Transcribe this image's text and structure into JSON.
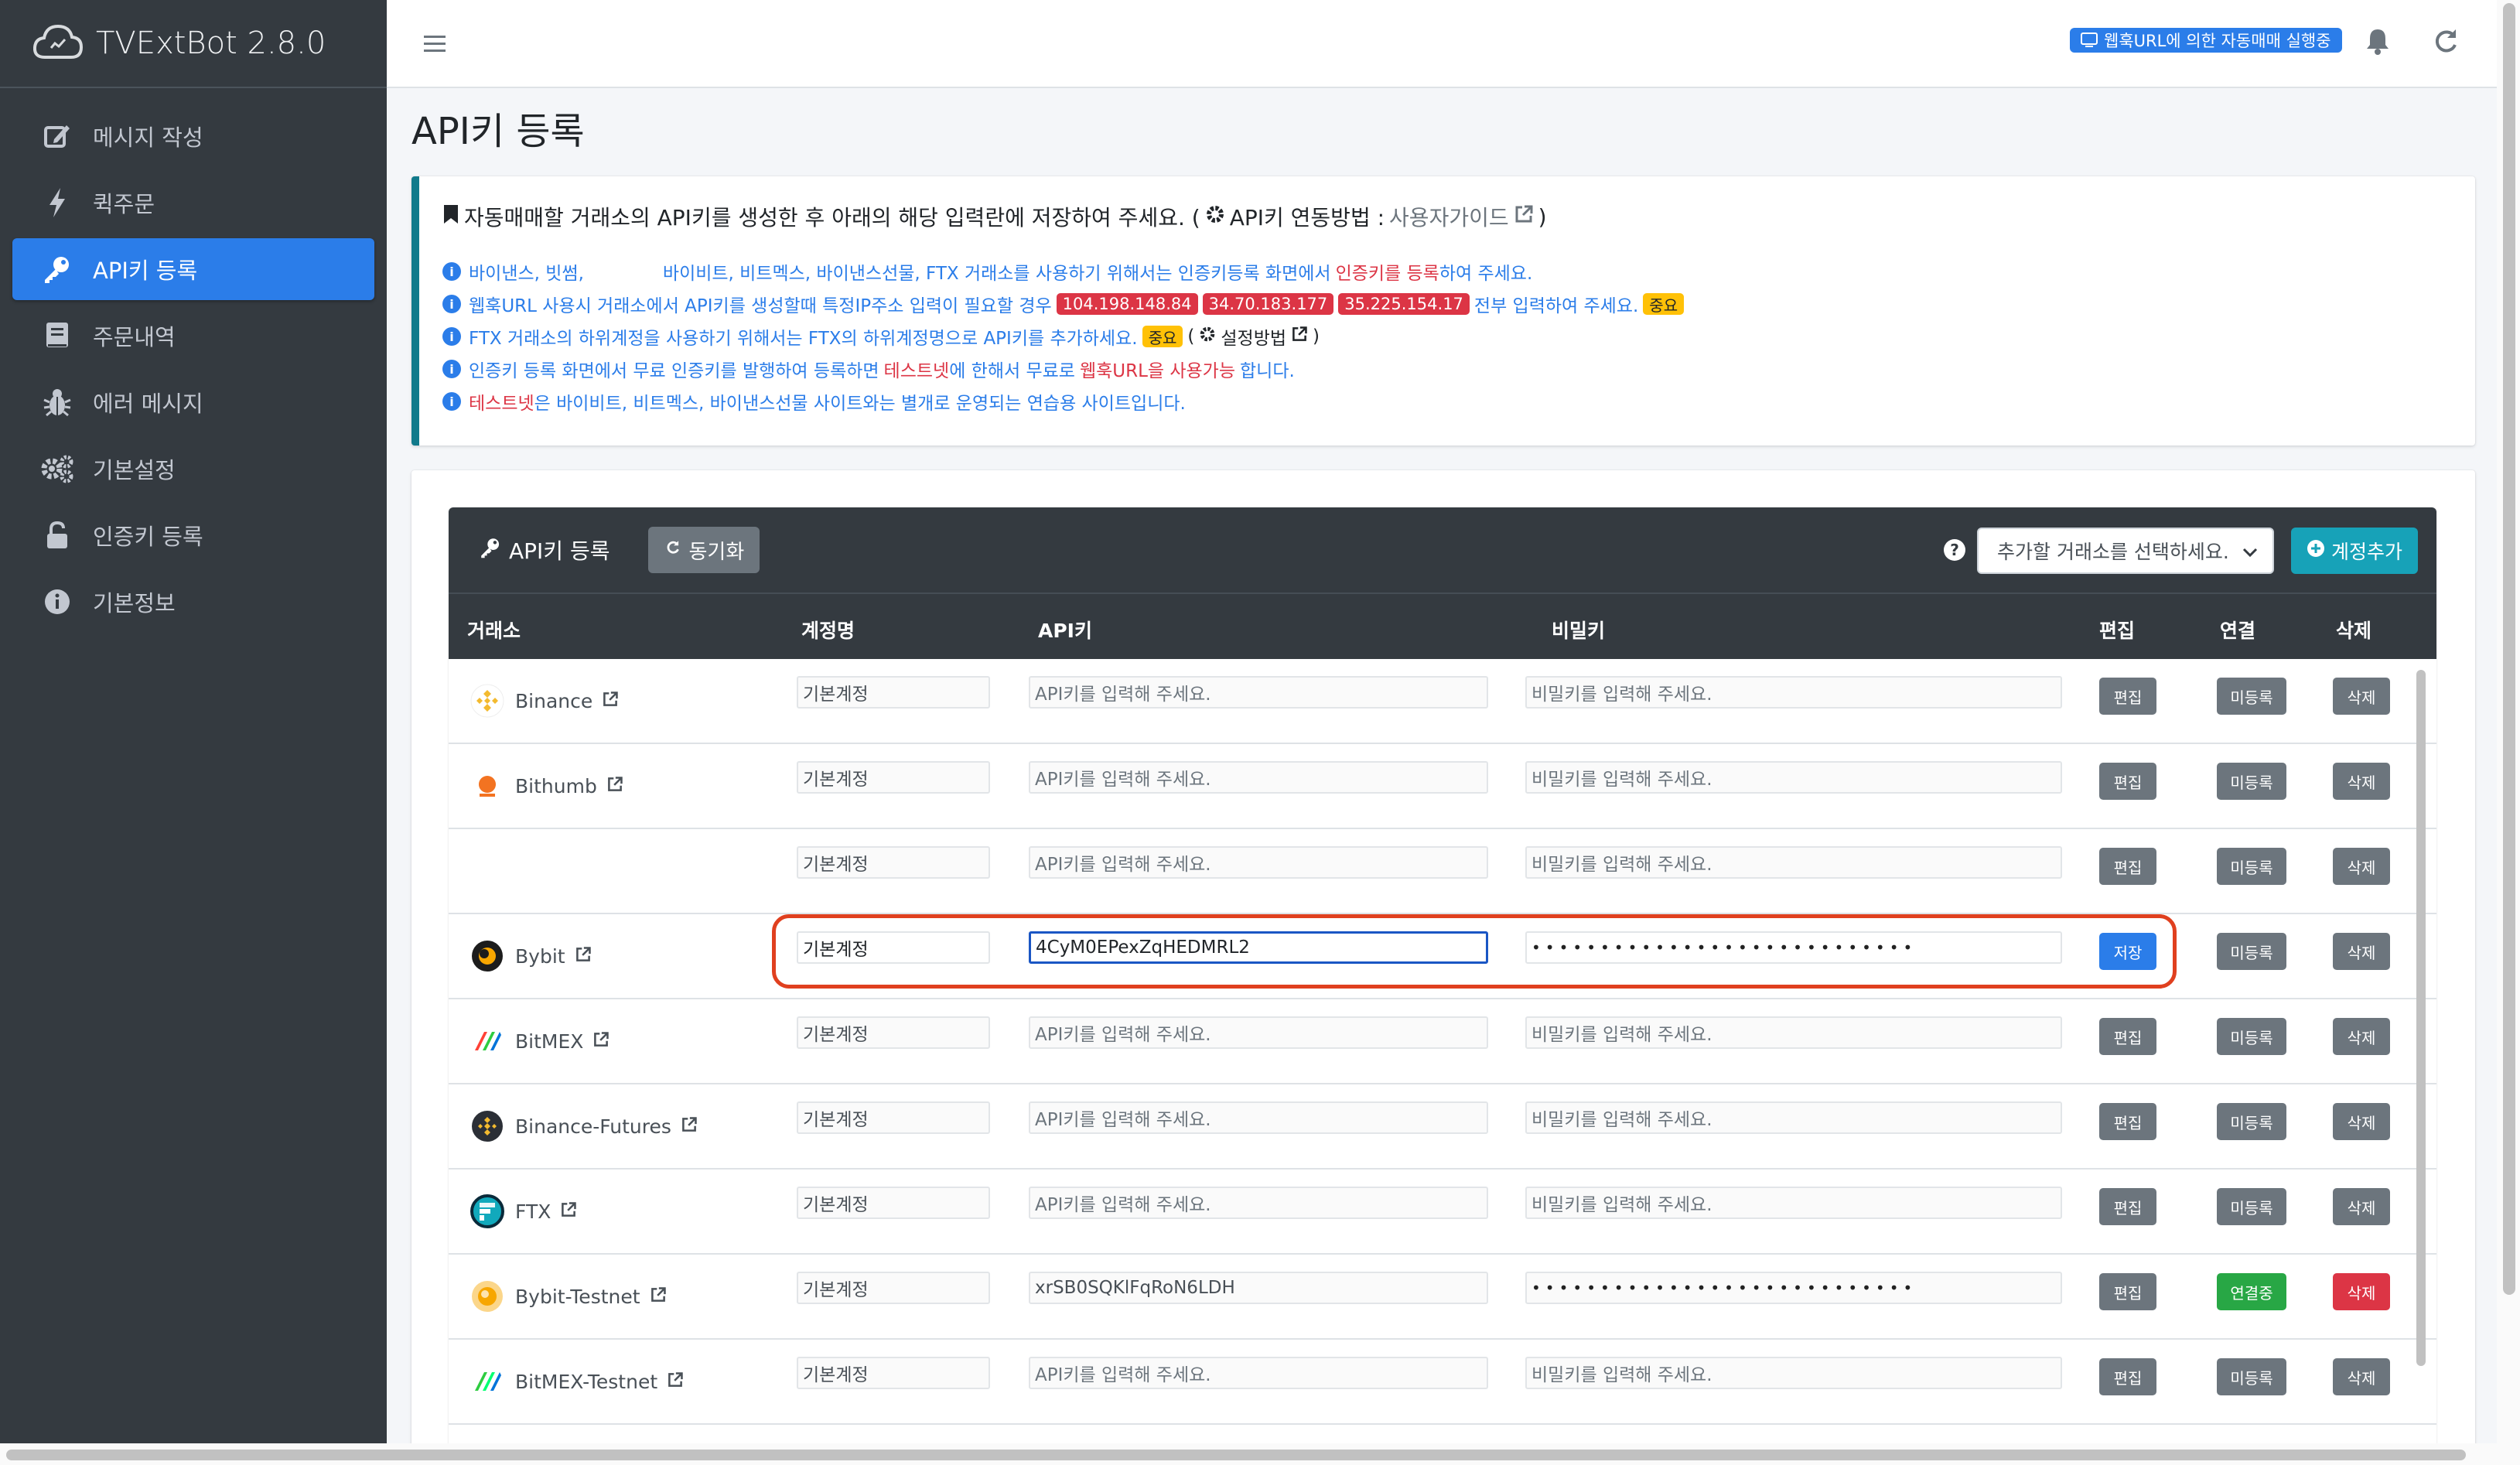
{
  "app": {
    "name": "TVExtBot 2.8.0"
  },
  "sidebar": {
    "items": [
      {
        "label": "메시지 작성",
        "icon": "edit-icon"
      },
      {
        "label": "퀵주문",
        "icon": "bolt-icon"
      },
      {
        "label": "API키 등록",
        "icon": "key-icon",
        "active": true
      },
      {
        "label": "주문내역",
        "icon": "book-icon"
      },
      {
        "label": "에러 메시지",
        "icon": "bug-icon"
      },
      {
        "label": "기본설정",
        "icon": "cogs-icon"
      },
      {
        "label": "인증키 등록",
        "icon": "unlock-icon"
      },
      {
        "label": "기본정보",
        "icon": "info-icon"
      }
    ]
  },
  "topbar": {
    "badge": "웹훅URL에 의한 자동매매 실행중"
  },
  "page": {
    "title": "API키 등록"
  },
  "callout": {
    "head_text": "자동매매할 거래소의 API키를 생성한 후 아래의 해당 입력란에 저장하여 주세요. (",
    "head_link_label": "API키 연동방법 : ",
    "head_link": "사용자가이드",
    "head_close": ")",
    "line1_a": "바이낸스, 빗썸,",
    "line1_b": "바이비트, 비트멕스, 바이낸스선물, FTX 거래소를 사용하기 위해서는 인증키등록 화면에서",
    "line1_red": "인증키를 등록",
    "line1_c": "하여 주세요.",
    "line2_a": "웹훅URL 사용시 거래소에서 API키를 생성할때 특정IP주소 입력이 필요할 경우",
    "ips": [
      "104.198.148.84",
      "34.70.183.177",
      "35.225.154.17"
    ],
    "line2_b": "전부 입력하여 주세요.",
    "badge_important": "중요",
    "line3_a": "FTX 거래소의 하위계정을 사용하기 위해서는 FTX의 하위계정명으로 API키를 추가하세요.",
    "line3_paren_open": "(",
    "line3_link": "설정방법",
    "line3_paren_close": ")",
    "line4_a": "인증키 등록 화면에서 무료 인증키를 발행하여 등록하면",
    "line4_red1": "테스트넷",
    "line4_b": "에 한해서 무료로",
    "line4_red2": "웹훅URL을 사용가능",
    "line4_c": "합니다.",
    "line5_red": "테스트넷",
    "line5_a": "은 바이비트, 비트멕스, 바이낸스선물 사이트와는 별개로 운영되는 연습용 사이트입니다."
  },
  "card": {
    "title": "API키 등록",
    "sync_label": "동기화",
    "select_placeholder": "추가할 거래소를 선택하세요.",
    "add_label": "계정추가"
  },
  "table": {
    "headers": {
      "exchange": "거래소",
      "account": "계정명",
      "api": "API키",
      "secret": "비밀키",
      "edit": "편집",
      "connect": "연결",
      "delete": "삭제"
    },
    "rows": [
      {
        "exchange": "Binance",
        "account": "기본계정",
        "api": "",
        "secret": "",
        "edit": "편집",
        "status": "미등록",
        "delete": "삭제"
      },
      {
        "exchange": "Bithumb",
        "account": "기본계정",
        "api": "",
        "secret": "",
        "edit": "편집",
        "status": "미등록",
        "delete": "삭제"
      },
      {
        "exchange": "",
        "account": "기본계정",
        "api": "",
        "secret": "",
        "edit": "편집",
        "status": "미등록",
        "delete": "삭제"
      },
      {
        "exchange": "Bybit",
        "account": "기본계정",
        "api": "4CyM0EPexZqHEDMRL2",
        "secret": "••••••••••••••••••••••••••••",
        "edit": "저장",
        "status": "미등록",
        "delete": "삭제"
      },
      {
        "exchange": "BitMEX",
        "account": "기본계정",
        "api": "",
        "secret": "",
        "edit": "편집",
        "status": "미등록",
        "delete": "삭제"
      },
      {
        "exchange": "Binance-Futures",
        "account": "기본계정",
        "api": "",
        "secret": "",
        "edit": "편집",
        "status": "미등록",
        "delete": "삭제"
      },
      {
        "exchange": "FTX",
        "account": "기본계정",
        "api": "",
        "secret": "",
        "edit": "편집",
        "status": "미등록",
        "delete": "삭제"
      },
      {
        "exchange": "Bybit-Testnet",
        "account": "기본계정",
        "api": "xrSB0SQKlFqRoN6LDH",
        "secret": "••••••••••••••••••••••••••••",
        "edit": "편집",
        "status": "연결중",
        "delete": "삭제"
      },
      {
        "exchange": "BitMEX-Testnet",
        "account": "기본계정",
        "api": "",
        "secret": "",
        "edit": "편집",
        "status": "미등록",
        "delete": "삭제"
      }
    ],
    "api_placeholder": "API키를 입력해 주세요.",
    "secret_placeholder": "비밀키를 입력해 주세요."
  },
  "colors": {
    "sidebar": "#343a40",
    "accent": "#2b7de9",
    "success": "#28a745",
    "danger": "#dc3545",
    "warning": "#ffc107",
    "info": "#17a2b8"
  }
}
